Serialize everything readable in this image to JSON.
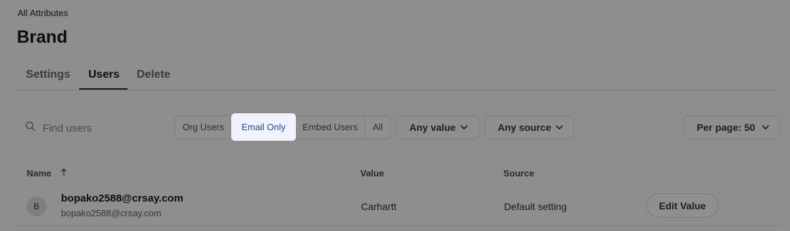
{
  "breadcrumb": "All Attributes",
  "page_title": "Brand",
  "tabs": [
    {
      "label": "Settings",
      "active": false
    },
    {
      "label": "Users",
      "active": true
    },
    {
      "label": "Delete",
      "active": false
    }
  ],
  "search": {
    "placeholder": "Find users",
    "value": ""
  },
  "filter_segments": {
    "items": [
      "Org Users",
      "Email Only",
      "Embed Users",
      "All"
    ],
    "selected": "Email Only"
  },
  "dropdowns": {
    "value": "Any value",
    "source": "Any source",
    "per_page": "Per page: 50"
  },
  "table": {
    "columns": {
      "name": "Name",
      "value": "Value",
      "source": "Source"
    },
    "rows": [
      {
        "avatar_initial": "B",
        "name": "bopako2588@crsay.com",
        "email": "bopako2588@crsay.com",
        "value": "Carhartt",
        "source": "Default setting",
        "action": "Edit Value"
      }
    ]
  },
  "icons": {
    "search": "search-icon",
    "sort": "arrow-up-icon",
    "dropdown": "chevron-down-icon"
  },
  "colors": {
    "overlay_bg": "#8e8e8e",
    "selected_segment_bg": "#eef3fd",
    "selected_segment_text": "#2a4a8a"
  }
}
